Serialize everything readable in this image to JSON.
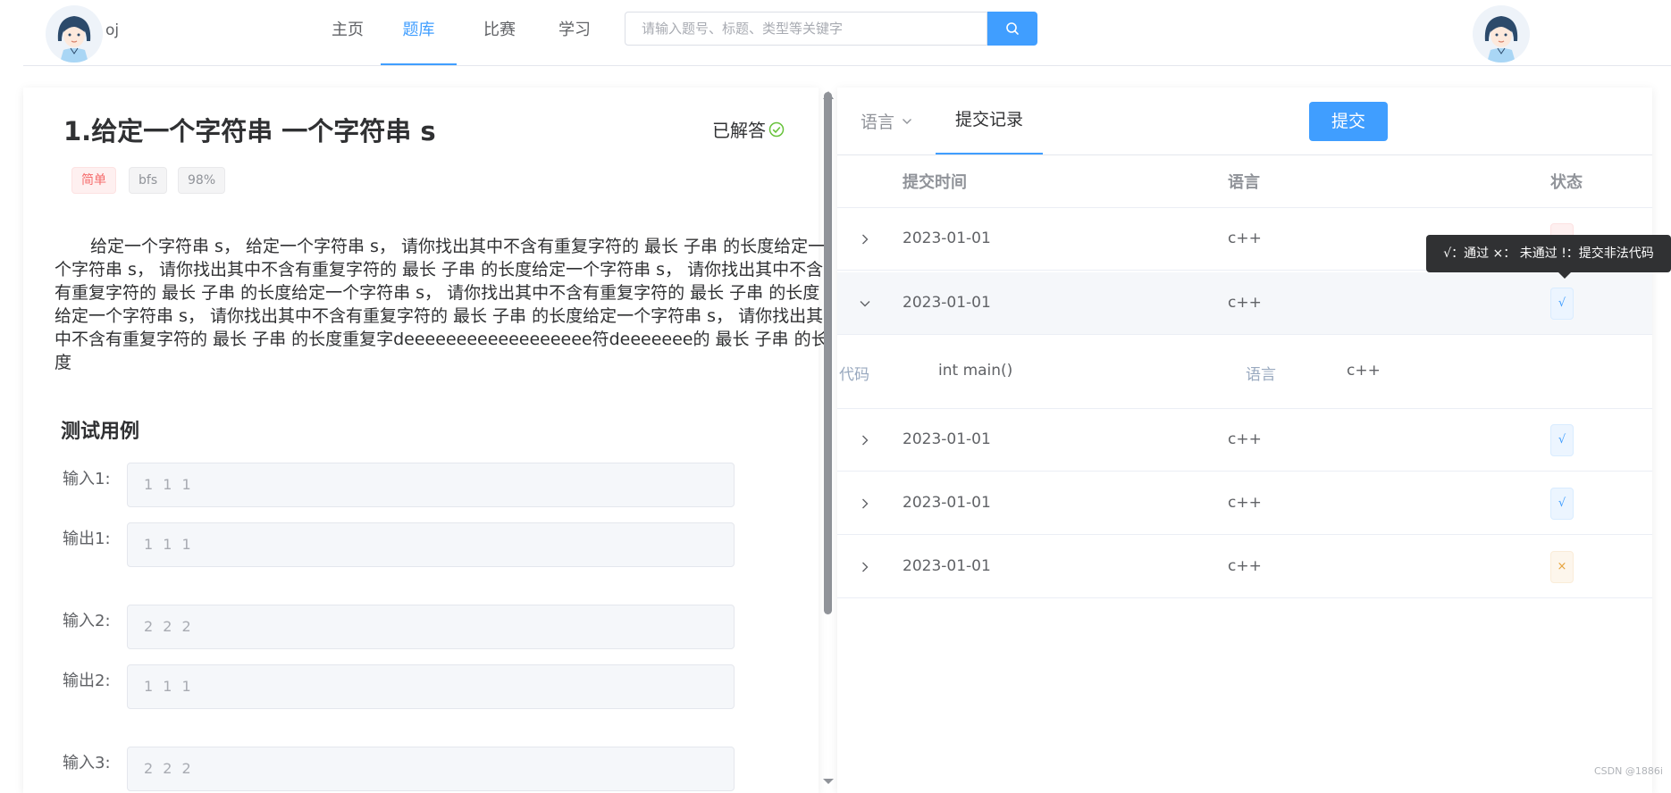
{
  "header": {
    "brand": "oj",
    "nav": [
      "主页",
      "题库",
      "比赛",
      "学习"
    ],
    "active_nav": "题库",
    "search_placeholder": "请输入题号、标题、类型等关键字",
    "search_icon": "search-icon",
    "accent": "#409eff"
  },
  "problem": {
    "title": "1.给定一个字符串 一个字符串 s",
    "status": "已解答",
    "status_color": "#67c23a",
    "tags": [
      "简单",
      "bfs",
      "98%"
    ],
    "description": "给定一个字符串 s， 给定一个字符串 s， 请你找出其中不含有重复字符的 最长 子串 的长度给定一个字符串 s， 请你找出其中不含有重复字符的 最长 子串 的长度给定一个字符串 s， 请你找出其中不含有重复字符的 最长 子串 的长度给定一个字符串 s， 请你找出其中不含有重复字符的 最长 子串 的长度给定一个字符串 s， 请你找出其中不含有重复字符的 最长 子串 的长度给定一个字符串 s， 请你找出其中不含有重复字符的 最长 子串 的长度重复字deeeeeeeeeeeeeeeeee符deeeeeee的 最长 子串 的长度",
    "test_title": "测试用例",
    "cases": [
      {
        "label": "输入1:",
        "value": "1 1 1"
      },
      {
        "label": "输出1:",
        "value": "1 1 1"
      },
      {
        "label": "输入2:",
        "value": "2 2 2"
      },
      {
        "label": "输出2:",
        "value": "1 1 1"
      },
      {
        "label": "输入3:",
        "value": "2 2 2"
      }
    ]
  },
  "right": {
    "tab_language": "语言",
    "tab_records": "提交记录",
    "submit": "提交",
    "columns": [
      "提交时间",
      "语言",
      "状态"
    ],
    "rows": [
      {
        "time": "2023-01-01",
        "lang": "c++",
        "status": "",
        "status_type": "err"
      },
      {
        "time": "2023-01-01",
        "lang": "c++",
        "status": "√",
        "status_type": "ok"
      },
      {
        "time": "2023-01-01",
        "lang": "c++",
        "status": "√",
        "status_type": "ok"
      },
      {
        "time": "2023-01-01",
        "lang": "c++",
        "status": "√",
        "status_type": "ok"
      },
      {
        "time": "2023-01-01",
        "lang": "c++",
        "status": "×",
        "status_type": "bad"
      }
    ],
    "expanded": {
      "code_label": "代码",
      "code_value": "int main()",
      "lang_label": "语言",
      "lang_value": "c++"
    },
    "tooltip": "√：通过 ×：  未通过 !：提交非法代码"
  },
  "watermark": "CSDN @1886i"
}
